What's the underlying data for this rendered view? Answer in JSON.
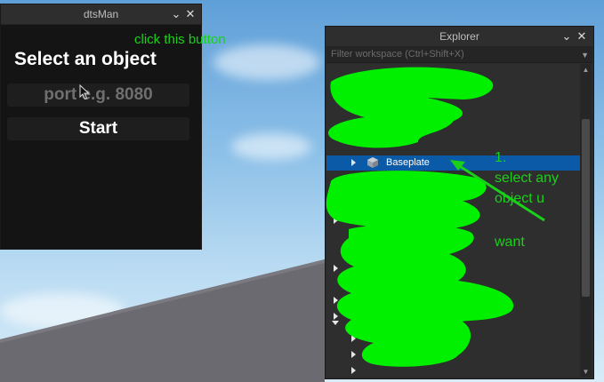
{
  "dtsman": {
    "title": "dtsMan",
    "heading": "Select an object",
    "port_placeholder": "port e.g. 8080",
    "start_label": "Start"
  },
  "explorer": {
    "title": "Explorer",
    "filter_placeholder": "Filter workspace (Ctrl+Shift+X)",
    "selected_item": "Baseplate"
  },
  "annotations": {
    "click_hint": "click this button",
    "step_number": "1.",
    "step_line1": "select any",
    "step_line2": "object u",
    "step_line3": "want"
  },
  "colors": {
    "annotation": "#19d119",
    "scribble": "#00f000",
    "selection": "#0b5aa8"
  }
}
